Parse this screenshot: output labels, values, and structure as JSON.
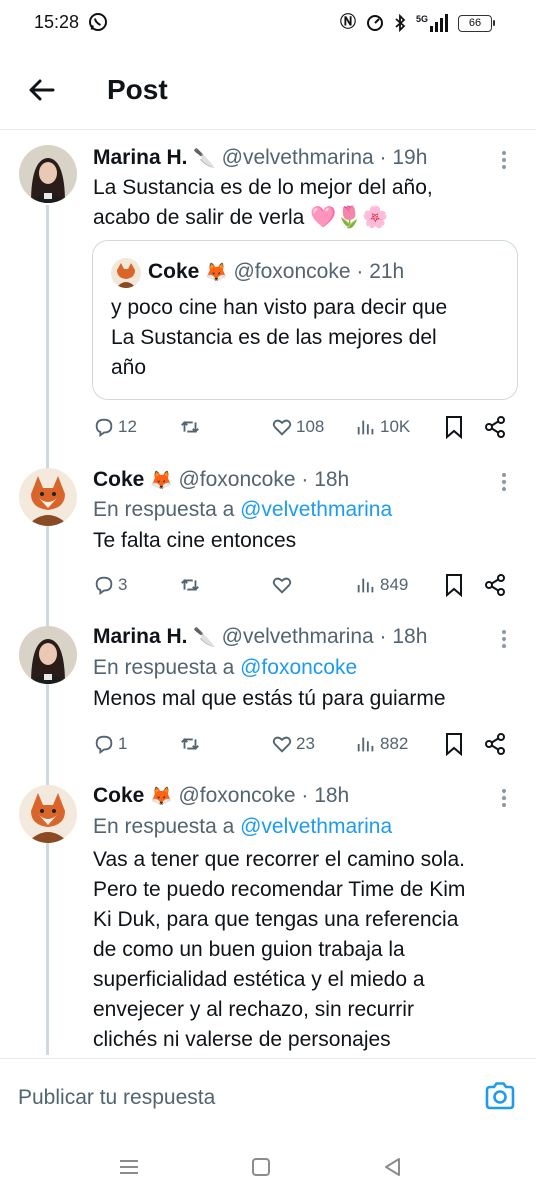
{
  "status_bar": {
    "time": "15:28",
    "network": "5G",
    "battery": "66"
  },
  "header": {
    "title": "Post"
  },
  "tweets": [
    {
      "name": "Marina H.",
      "name_emoji": "🔪",
      "handle": "@velvethmarina",
      "time": "· 19h",
      "text_lines": [
        "La Sustancia es de lo mejor del año,",
        "acabo de salir de verla 🩷🌷🌸"
      ],
      "quote": {
        "name": "Coke",
        "name_emoji": "🦊",
        "handle": "@foxoncoke",
        "time": "· 21h",
        "text_lines": [
          "y poco cine han visto para decir que",
          "La Sustancia es de las mejores del",
          "año"
        ]
      },
      "replies": "12",
      "reposts": "",
      "likes": "108",
      "views": "10K"
    },
    {
      "name": "Coke",
      "name_emoji": "🦊",
      "handle": "@foxoncoke",
      "time": "· 18h",
      "reply_prefix": "En respuesta a",
      "reply_mention": "@velvethmarina",
      "text_lines": [
        "Te falta cine entonces"
      ],
      "replies": "3",
      "reposts": "",
      "likes": "",
      "views": "849"
    },
    {
      "name": "Marina H.",
      "name_emoji": "🔪",
      "handle": "@velvethmarina",
      "time": "· 18h",
      "reply_prefix": "En respuesta a",
      "reply_mention": "@foxoncoke",
      "text_lines": [
        "Menos mal que estás tú para guiarme"
      ],
      "replies": "1",
      "reposts": "",
      "likes": "23",
      "views": "882"
    },
    {
      "name": "Coke",
      "name_emoji": "🦊",
      "handle": "@foxoncoke",
      "time": "· 18h",
      "reply_prefix": "En respuesta a",
      "reply_mention": "@velvethmarina",
      "text_lines": [
        "Vas a tener que recorrer el camino sola.",
        "Pero te puedo recomendar Time de Kim",
        "Ki Duk, para que tengas una referencia",
        "de como un buen guion trabaja la",
        "superficialidad estética y el miedo a",
        "envejecer y al rechazo, sin recurrir",
        "clichés ni valerse de personajes"
      ]
    }
  ],
  "reply_bar": {
    "placeholder": "Publicar tu respuesta"
  },
  "colors": {
    "accent": "#1d9bf0",
    "text": "#0f1419",
    "muted": "#536471",
    "border": "#cfd9de"
  }
}
